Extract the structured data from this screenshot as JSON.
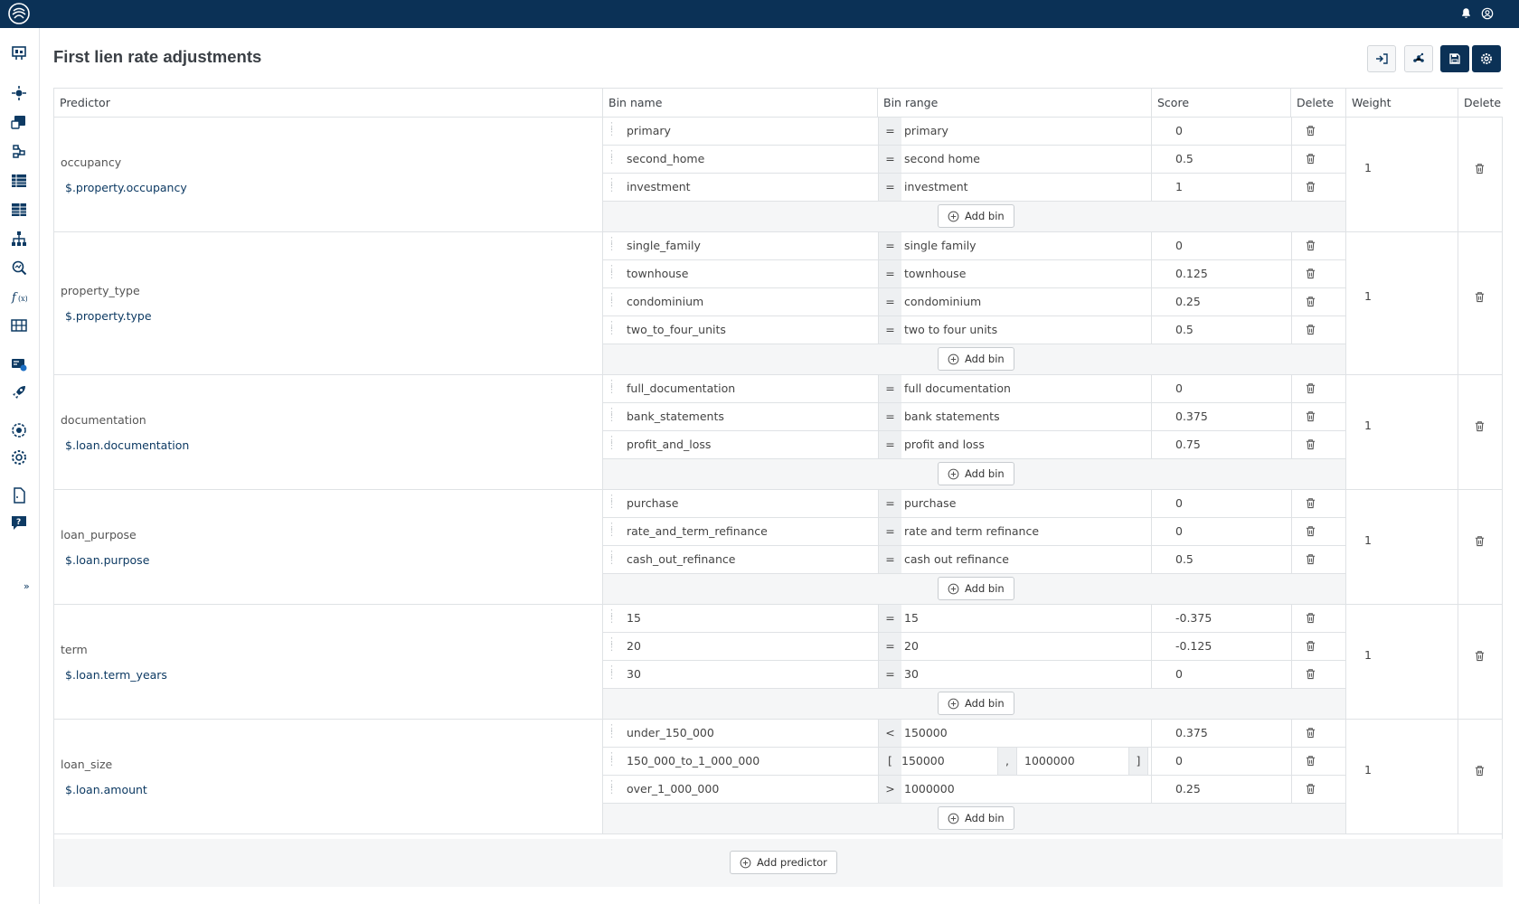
{
  "page": {
    "title": "First lien rate adjustments"
  },
  "toolbar": {
    "icons": [
      "import-icon",
      "share-nodes-icon",
      "save-icon",
      "gear-icon"
    ]
  },
  "columns": {
    "predictor": "Predictor",
    "bin_name": "Bin name",
    "bin_range": "Bin range",
    "score": "Score",
    "delete": "Delete",
    "weight": "Weight",
    "delete2": "Delete"
  },
  "predictors": [
    {
      "name": "occupancy",
      "path": "$.property.occupancy",
      "weight": "1",
      "bins": [
        {
          "name": "primary",
          "op": "=",
          "range": "primary",
          "score": "0"
        },
        {
          "name": "second_home",
          "op": "=",
          "range": "second home",
          "score": "0.5"
        },
        {
          "name": "investment",
          "op": "=",
          "range": "investment",
          "score": "1"
        }
      ]
    },
    {
      "name": "property_type",
      "path": "$.property.type",
      "weight": "1",
      "bins": [
        {
          "name": "single_family",
          "op": "=",
          "range": "single family",
          "score": "0"
        },
        {
          "name": "townhouse",
          "op": "=",
          "range": "townhouse",
          "score": "0.125"
        },
        {
          "name": "condominium",
          "op": "=",
          "range": "condominium",
          "score": "0.25"
        },
        {
          "name": "two_to_four_units",
          "op": "=",
          "range": "two to four units",
          "score": "0.5"
        }
      ]
    },
    {
      "name": "documentation",
      "path": "$.loan.documentation",
      "weight": "1",
      "bins": [
        {
          "name": "full_documentation",
          "op": "=",
          "range": "full documentation",
          "score": "0"
        },
        {
          "name": "bank_statements",
          "op": "=",
          "range": "bank statements",
          "score": "0.375"
        },
        {
          "name": "profit_and_loss",
          "op": "=",
          "range": "profit and loss",
          "score": "0.75"
        }
      ]
    },
    {
      "name": "loan_purpose",
      "path": "$.loan.purpose",
      "weight": "1",
      "bins": [
        {
          "name": "purchase",
          "op": "=",
          "range": "purchase",
          "score": "0"
        },
        {
          "name": "rate_and_term_refinance",
          "op": "=",
          "range": "rate and term refinance",
          "score": "0"
        },
        {
          "name": "cash_out_refinance",
          "op": "=",
          "range": "cash out refinance",
          "score": "0.5"
        }
      ]
    },
    {
      "name": "term",
      "path": "$.loan.term_years",
      "weight": "1",
      "bins": [
        {
          "name": "15",
          "op": "=",
          "range": "15",
          "score": "-0.375"
        },
        {
          "name": "20",
          "op": "=",
          "range": "20",
          "score": "-0.125"
        },
        {
          "name": "30",
          "op": "=",
          "range": "30",
          "score": "0"
        }
      ]
    },
    {
      "name": "loan_size",
      "path": "$.loan.amount",
      "weight": "1",
      "bins": [
        {
          "name": "under_150_000",
          "op": "<",
          "range": "150000",
          "score": "0.375"
        },
        {
          "name": "150_000_to_1_000_000",
          "op": "[",
          "range_from": "150000",
          "range_sep": ",",
          "range_to": "1000000",
          "range_close": "]",
          "score": "0"
        },
        {
          "name": "over_1_000_000",
          "op": ">",
          "range": "1000000",
          "score": "0.25"
        }
      ]
    }
  ],
  "buttons": {
    "add_bin": "Add bin",
    "add_predictor": "Add predictor"
  },
  "sidebar": {
    "expand": "»"
  },
  "colors": {
    "brand": "#0b3156",
    "link": "#0d3a63"
  }
}
